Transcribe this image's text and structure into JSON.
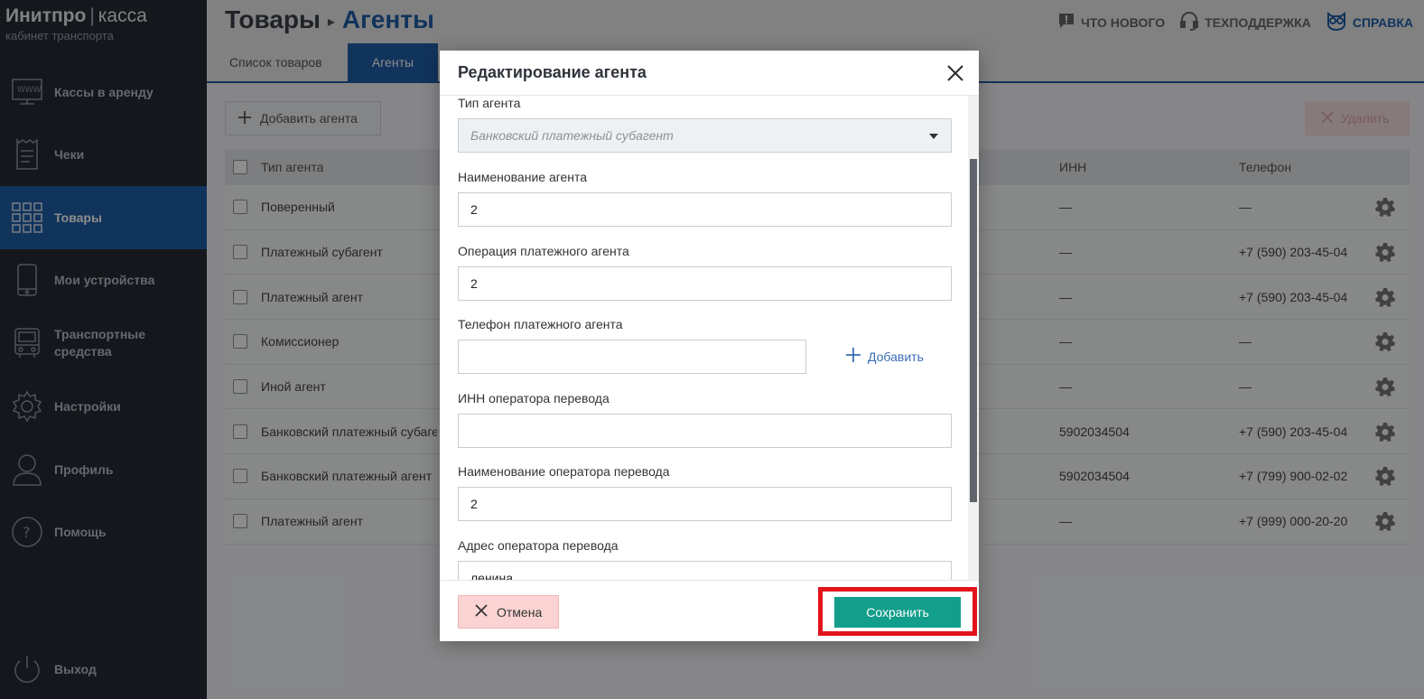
{
  "brand": {
    "name": "Инитпро",
    "product": "касса",
    "subtitle": "кабинет транспорта"
  },
  "sidebar": {
    "items": [
      {
        "label": "Кассы в аренду",
        "icon": "www-monitor-icon"
      },
      {
        "label": "Чеки",
        "icon": "receipt-icon"
      },
      {
        "label": "Товары",
        "icon": "grid-icon",
        "active": true
      },
      {
        "label": "Мои устройства",
        "icon": "phone-icon"
      },
      {
        "label": "Транспортные средства",
        "icon": "bus-icon"
      },
      {
        "label": "Настройки",
        "icon": "gear-icon"
      },
      {
        "label": "Профиль",
        "icon": "user-icon"
      },
      {
        "label": "Помощь",
        "icon": "question-icon"
      }
    ],
    "logout": "Выход"
  },
  "header": {
    "crumb_parent": "Товары",
    "crumb_current": "Агенты",
    "links": {
      "news": "ЧТО НОВОГО",
      "support": "ТЕХПОДДЕРЖКА",
      "help": "СПРАВКА"
    }
  },
  "tabs": [
    {
      "label": "Список товаров"
    },
    {
      "label": "Агенты",
      "active": true
    }
  ],
  "toolbar": {
    "add_label": "Добавить агента",
    "delete_label": "Удалить"
  },
  "table": {
    "columns": {
      "type": "Тип агента",
      "inn": "ИНН",
      "phone": "Телефон"
    },
    "rows": [
      {
        "type": "Поверенный",
        "inn": "—",
        "phone": "—"
      },
      {
        "type": "Платежный субагент",
        "inn": "—",
        "phone": "+7 (590) 203-45-04"
      },
      {
        "type": "Платежный агент",
        "inn": "—",
        "phone": "+7 (590) 203-45-04"
      },
      {
        "type": "Комиссионер",
        "inn": "—",
        "phone": "—"
      },
      {
        "type": "Иной агент",
        "inn": "—",
        "phone": "—"
      },
      {
        "type": "Банковский платежный субагент",
        "inn": "5902034504",
        "phone": "+7 (590) 203-45-04"
      },
      {
        "type": "Банковский платежный агент",
        "inn": "5902034504",
        "phone": "+7 (799) 900-02-02"
      },
      {
        "type": "Платежный агент",
        "inn": "—",
        "phone": "+7 (999) 000-20-20"
      }
    ]
  },
  "modal": {
    "title": "Редактирование агента",
    "fields": {
      "agent_type": {
        "label": "Тип агента",
        "value": "Банковский платежный субагент"
      },
      "agent_name": {
        "label": "Наименование агента",
        "value": "2"
      },
      "agent_operation": {
        "label": "Операция платежного агента",
        "value": "2"
      },
      "agent_phone": {
        "label": "Телефон платежного агента",
        "value": "",
        "add_label": "Добавить"
      },
      "operator_inn": {
        "label": "ИНН оператора перевода",
        "value": ""
      },
      "operator_name": {
        "label": "Наименование оператора перевода",
        "value": "2"
      },
      "operator_address": {
        "label": "Адрес оператора перевода",
        "value": "ленина"
      }
    },
    "cancel_label": "Отмена",
    "save_label": "Сохранить"
  },
  "colors": {
    "accent": "#1f5fa8",
    "sidebar": "#252b33",
    "save": "#129e8a",
    "highlight": "#e3141c",
    "cancel": "#fbd3d3"
  }
}
